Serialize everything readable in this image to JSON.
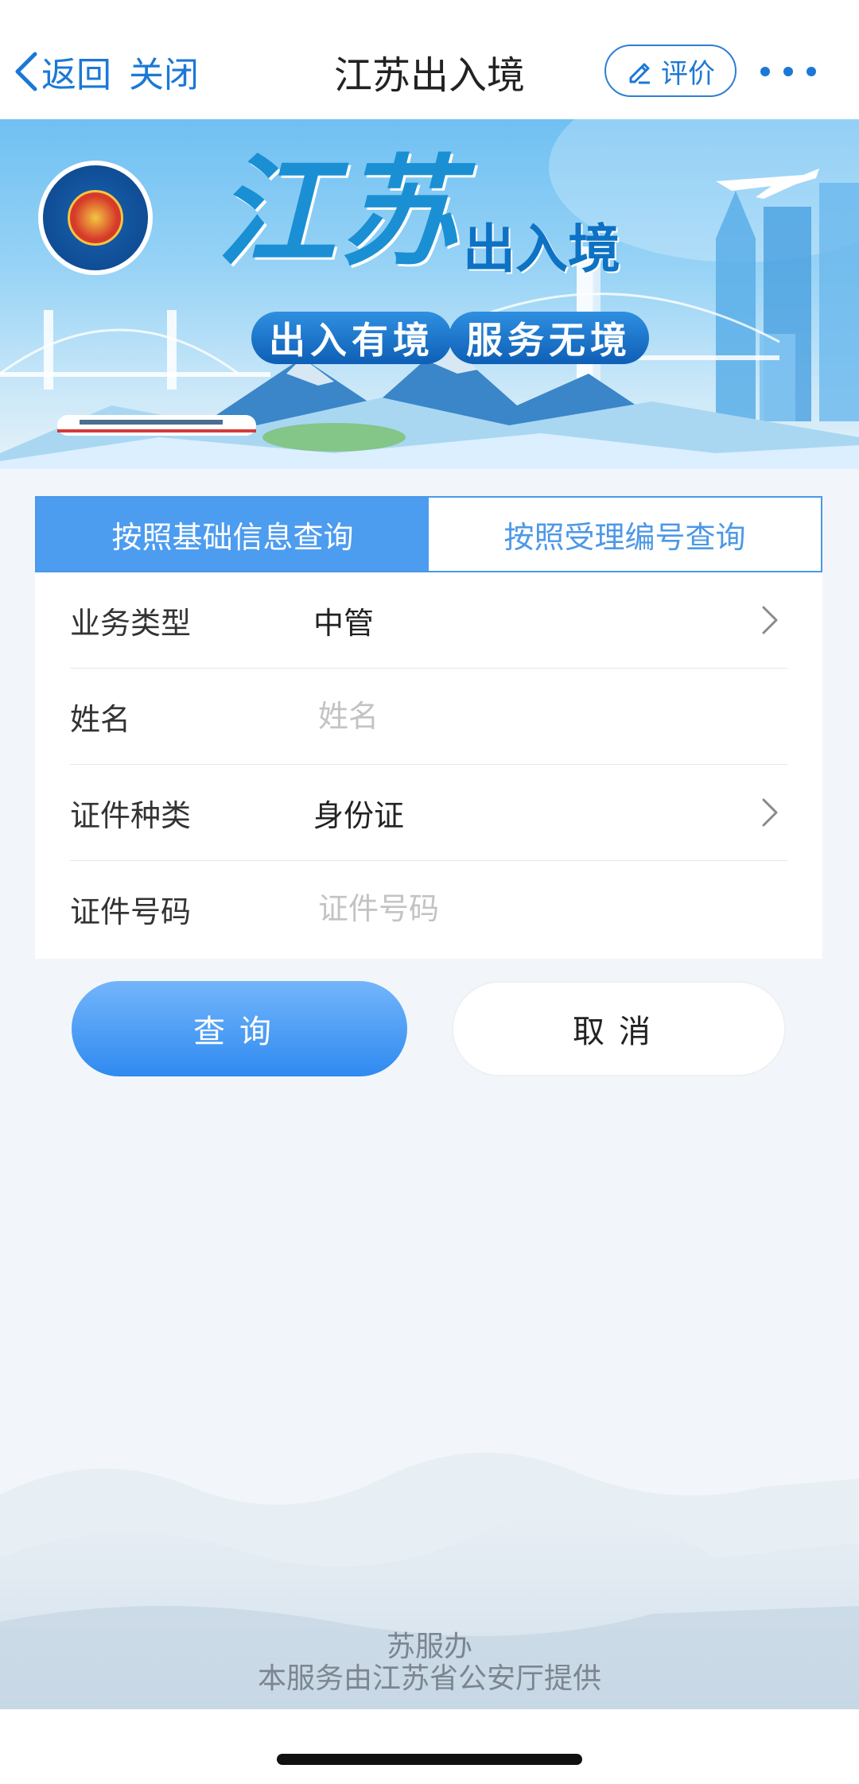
{
  "header": {
    "back_label": "返回",
    "close_label": "关闭",
    "title": "江苏出入境",
    "rate_label": "评价"
  },
  "banner": {
    "title_script": "江苏",
    "title_suffix": "出入境",
    "slogans": [
      "出入有境",
      "服务无境"
    ],
    "emblem_name": "china-immigration-emblem-icon"
  },
  "tabs": [
    {
      "label": "按照基础信息查询",
      "active": true
    },
    {
      "label": "按照受理编号查询",
      "active": false
    }
  ],
  "form": {
    "fields": [
      {
        "label": "业务类型",
        "value": "中管",
        "type": "select"
      },
      {
        "label": "姓名",
        "value": "",
        "placeholder": "姓名",
        "type": "input"
      },
      {
        "label": "证件种类",
        "value": "身份证",
        "type": "select"
      },
      {
        "label": "证件号码",
        "value": "",
        "placeholder": "证件号码",
        "type": "input"
      }
    ]
  },
  "actions": {
    "query_label": "查询",
    "cancel_label": "取消"
  },
  "footer": {
    "line1": "苏服办",
    "line2": "本服务由江苏省公安厅提供"
  },
  "colors": {
    "accent": "#1b78d6",
    "tab_active": "#4c9cf0",
    "button_gradient_top": "#73b5fb",
    "button_gradient_bottom": "#2f8af0",
    "background": "#f2f6fa"
  }
}
